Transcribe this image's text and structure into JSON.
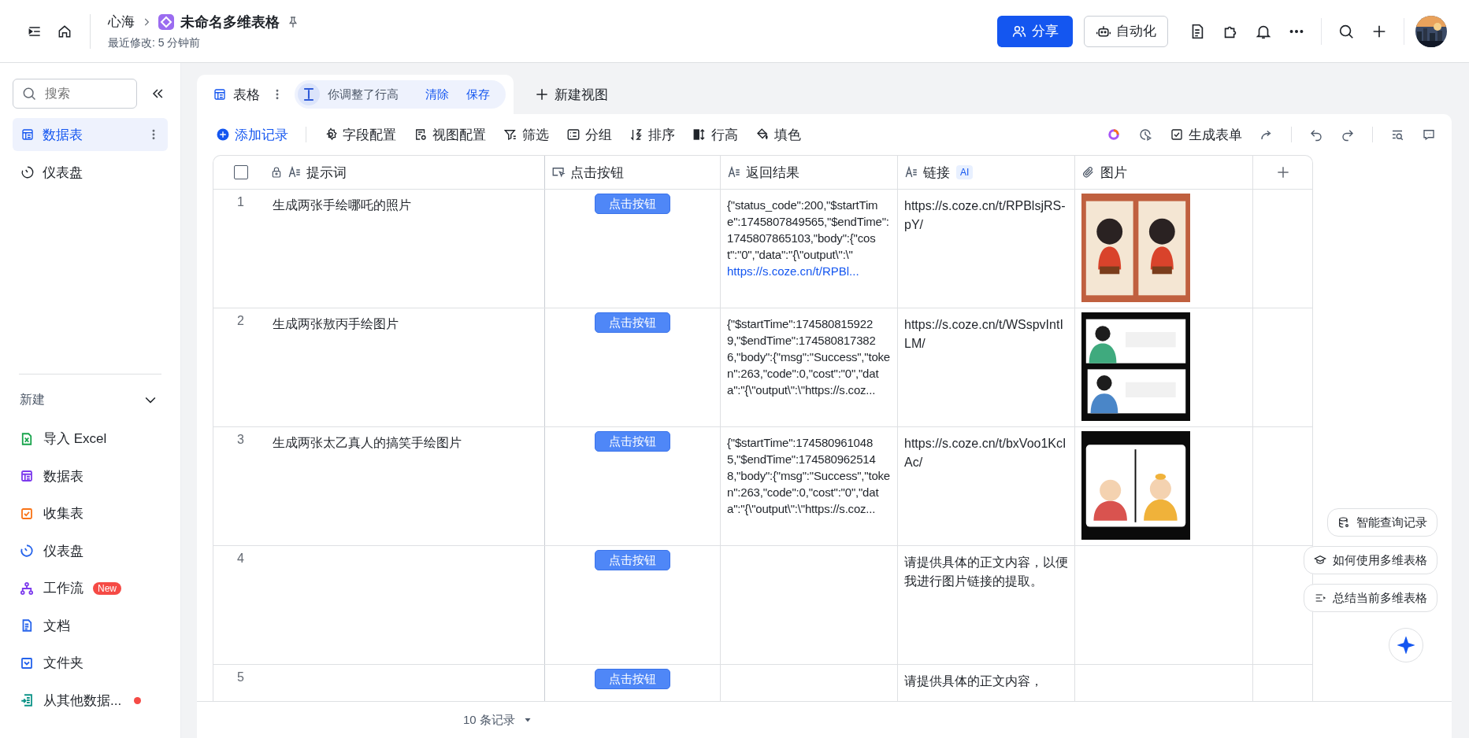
{
  "header": {
    "breadcrumb": "心海",
    "title": "未命名多维表格",
    "subtitle": "最近修改: 5 分钟前",
    "share_button": "分享",
    "automation_button": "自动化",
    "icon_groups": [
      [
        {
          "kind": "doc"
        },
        {
          "kind": "plugin"
        },
        {
          "kind": "bell"
        },
        {
          "kind": "more"
        }
      ],
      [
        {
          "kind": "search"
        },
        {
          "kind": "plus"
        }
      ]
    ]
  },
  "sidebar": {
    "search": {
      "placeholder": "搜索"
    },
    "nav": [
      {
        "label": "数据表",
        "kind": "table",
        "selected": true
      },
      {
        "label": "仪表盘",
        "kind": "dashboard",
        "selected": false
      }
    ],
    "create_section": {
      "title": "新建",
      "expanded": true,
      "items": [
        {
          "label": "导入 Excel",
          "kind": "excel",
          "color": "#16a34a",
          "dot": false
        },
        {
          "label": "数据表",
          "kind": "table",
          "color": "#7c3aed",
          "dot": false
        },
        {
          "label": "收集表",
          "kind": "form",
          "color": "#f97316",
          "dot": false
        },
        {
          "label": "仪表盘",
          "kind": "dashboard",
          "color": "#2563eb",
          "dot": false
        },
        {
          "label": "工作流",
          "kind": "workflow",
          "color": "#7c3aed",
          "badge": "New",
          "dot": false
        },
        {
          "label": "文档",
          "kind": "doc",
          "color": "#2563eb",
          "dot": false
        },
        {
          "label": "文件夹",
          "kind": "folder",
          "color": "#2563eb",
          "dot": false
        },
        {
          "label": "从其他数据...",
          "kind": "import",
          "color": "#0d9488",
          "dot": true
        }
      ]
    }
  },
  "views": {
    "tabs": [
      {
        "label": "表格",
        "selected": true
      }
    ],
    "notice": {
      "text": "你调整了行高",
      "actions": [
        "清除",
        "保存"
      ]
    },
    "new_view": "新建视图"
  },
  "toolbar": {
    "left_groups": [
      [
        {
          "label": "添加记录",
          "kind": "add"
        }
      ],
      [
        {
          "label": "字段配置",
          "kind": "fields"
        },
        {
          "label": "视图配置",
          "kind": "viewcfg"
        },
        {
          "label": "筛选",
          "kind": "filter"
        },
        {
          "label": "分组",
          "kind": "group"
        },
        {
          "label": "排序",
          "kind": "sort"
        },
        {
          "label": "行高",
          "kind": "rowheight"
        },
        {
          "label": "填色",
          "kind": "fill"
        }
      ]
    ],
    "right_groups": [
      [
        {
          "kind": "ai-ring"
        },
        {
          "kind": "history"
        },
        {
          "label": "生成表单",
          "kind": "form"
        },
        {
          "kind": "share"
        }
      ],
      [
        {
          "kind": "undo"
        },
        {
          "kind": "redo"
        }
      ],
      [
        {
          "kind": "find"
        },
        {
          "kind": "comment"
        }
      ]
    ]
  },
  "table": {
    "select_all": {
      "checked": false
    },
    "columns": [
      {
        "label": "提示词",
        "kind": "text",
        "locked": true
      },
      {
        "label": "点击按钮",
        "kind": "button",
        "locked": false
      },
      {
        "label": "返回结果",
        "kind": "text",
        "locked": false
      },
      {
        "label": "链接",
        "kind": "text",
        "locked": false,
        "badge": "AI"
      },
      {
        "label": "图片",
        "kind": "attachment",
        "locked": false
      }
    ],
    "rows": [
      {
        "index": "1",
        "prompt": "生成两张手绘哪吒的照片",
        "button": "点击按钮",
        "result": "{\"status_code\":200,\"$startTime\":1745807849565,\"$endTime\":1745807865103,\"body\":{\"cost\":\"0\",\"data\":\"{\\\"output\\\":\\\"",
        "result_link": "https://s.coze.cn/t/RPBl...",
        "link": "https://s.coze.cn/t/RPBlsjRS-pY/"
      },
      {
        "index": "2",
        "prompt": "生成两张敖丙手绘图片",
        "button": "点击按钮",
        "result": "{\"$startTime\":1745808159229,\"$endTime\":1745808173826,\"body\":{\"msg\":\"Success\",\"token\":263,\"code\":0,\"cost\":\"0\",\"data\":\"{\\\"output\\\":\\\"https://s.coz...",
        "link": "https://s.coze.cn/t/WSspvIntILM/"
      },
      {
        "index": "3",
        "prompt": "生成两张太乙真人的搞笑手绘图片",
        "button": "点击按钮",
        "result": "{\"$startTime\":1745809610485,\"$endTime\":1745809625148,\"body\":{\"msg\":\"Success\",\"token\":263,\"code\":0,\"cost\":\"0\",\"data\":\"{\\\"output\\\":\\\"https://s.coz...",
        "link": "https://s.coze.cn/t/bxVoo1KcIAc/"
      },
      {
        "index": "4",
        "button": "点击按钮",
        "link": "请提供具体的正文内容，以便我进行图片链接的提取。"
      },
      {
        "index": "5",
        "button": "点击按钮",
        "link": "请提供具体的正文内容，"
      }
    ]
  },
  "footer": {
    "count": "10 条记录"
  },
  "assistant": {
    "suggestions": [
      {
        "label": "智能查询记录",
        "kind": "query"
      },
      {
        "label": "如何使用多维表格",
        "kind": "help"
      },
      {
        "label": "总结当前多维表格",
        "kind": "summary"
      }
    ]
  }
}
